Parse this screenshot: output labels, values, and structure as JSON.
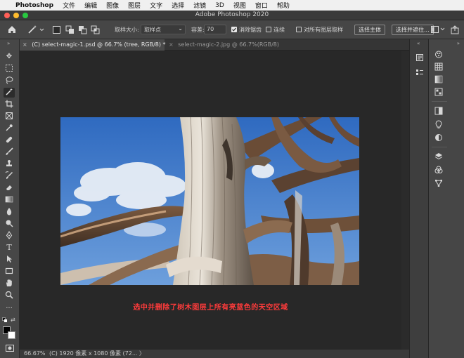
{
  "menubar": {
    "app": "Photoshop",
    "items": [
      "文件",
      "编辑",
      "图像",
      "图层",
      "文字",
      "选择",
      "滤镜",
      "3D",
      "视图",
      "窗口",
      "帮助"
    ]
  },
  "window": {
    "title": "Adobe Photoshop 2020"
  },
  "options": {
    "sample_size_label": "取样大小:",
    "sample_size_value": "取样点",
    "tolerance_label": "容差:",
    "tolerance_value": "70",
    "antialias_label": "消除锯齿",
    "antialias_checked": true,
    "contiguous_label": "连续",
    "contiguous_checked": false,
    "all_layers_label": "对所有图层取样",
    "all_layers_checked": false,
    "select_subject_label": "选择主体",
    "select_mask_label": "选择并遮住..."
  },
  "tabs": [
    {
      "label": "(C) select-magic-1.psd @ 66.7% (tree, RGB/8) *",
      "active": true
    },
    {
      "label": "select-magic-2.jpg @ 66.7%(RGB/8)",
      "active": false
    }
  ],
  "canvas": {
    "caption": "选中并删除了树木图层上所有亮蓝色的天空区域"
  },
  "status": {
    "zoom": "66.67%",
    "info": "(C) 1920 像素 x 1080 像素 (72... 〉"
  },
  "colors": {
    "accent": "#ff3b3b",
    "sky": "#3f7bc9",
    "wood": "#8a6a4f"
  }
}
